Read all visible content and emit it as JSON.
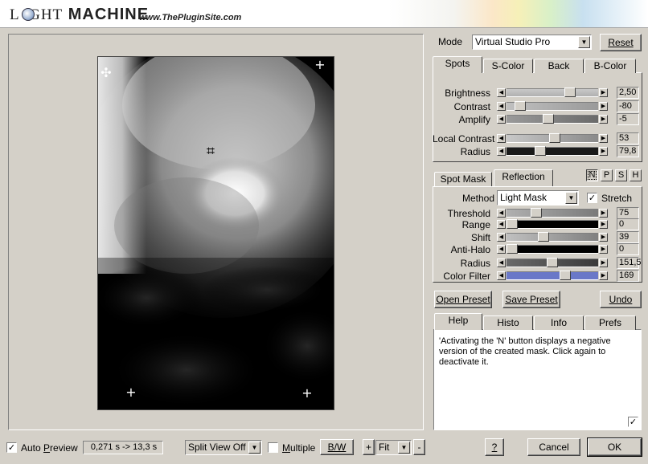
{
  "header": {
    "logo_light": "LIGHT",
    "logo_machine": "MACHINE",
    "url": "www.ThePluginSite.com"
  },
  "mode": {
    "label": "Mode",
    "value": "Virtual Studio Pro",
    "reset_label": "Reset"
  },
  "spots_tabs": [
    "Spots",
    "S-Color",
    "Back",
    "B-Color"
  ],
  "spots_sliders": [
    {
      "label": "Brightness",
      "value": "2,50",
      "position": 0.72
    },
    {
      "label": "Contrast",
      "value": "-80",
      "position": 0.1
    },
    {
      "label": "Amplify",
      "value": "-5",
      "position": 0.45
    },
    {
      "label": "Local Contrast",
      "value": "53",
      "position": 0.53
    },
    {
      "label": "Radius",
      "value": "79,8",
      "position": 0.35
    }
  ],
  "mask_tabs": [
    "Spot Mask",
    "Reflection"
  ],
  "mask_buttons": [
    "N",
    "P",
    "S",
    "H"
  ],
  "mask": {
    "method_label": "Method",
    "method_value": "Light Mask",
    "stretch_label": "Stretch",
    "stretch_checked": true,
    "sliders": [
      {
        "label": "Threshold",
        "value": "75",
        "position": 0.3
      },
      {
        "label": "Range",
        "value": "0",
        "position": 0.0
      },
      {
        "label": "Shift",
        "value": "39",
        "position": 0.39
      },
      {
        "label": "Anti-Halo",
        "value": "0",
        "position": 0.0
      },
      {
        "label": "Radius",
        "value": "151,5",
        "position": 0.5
      },
      {
        "label": "Color Filter",
        "value": "169",
        "position": 0.66
      }
    ]
  },
  "preset": {
    "open_label": "Open Preset",
    "save_label": "Save Preset",
    "undo_label": "Undo"
  },
  "info_tabs": [
    "Help",
    "Histo",
    "Info",
    "Prefs"
  ],
  "help_text": "'Activating the 'N' button displays a negative version of the created mask. Click again to deactivate it.",
  "bottom": {
    "auto_preview_label": "Auto Preview",
    "auto_preview_checked": true,
    "timing": "0,271 s -> 13,3 s",
    "split_view": "Split View Off",
    "multiple_label": "Multiple",
    "multiple_checked": false,
    "bw_label": "B/W",
    "plus_label": "+",
    "zoom_value": "Fit",
    "minus_label": "-",
    "help_button": "?",
    "cancel_label": "Cancel",
    "ok_label": "OK"
  },
  "colors": {
    "dialog_bg": "#d4d0c8",
    "color_filter_track": "#6a78c8",
    "preview_bg": "#000000"
  }
}
